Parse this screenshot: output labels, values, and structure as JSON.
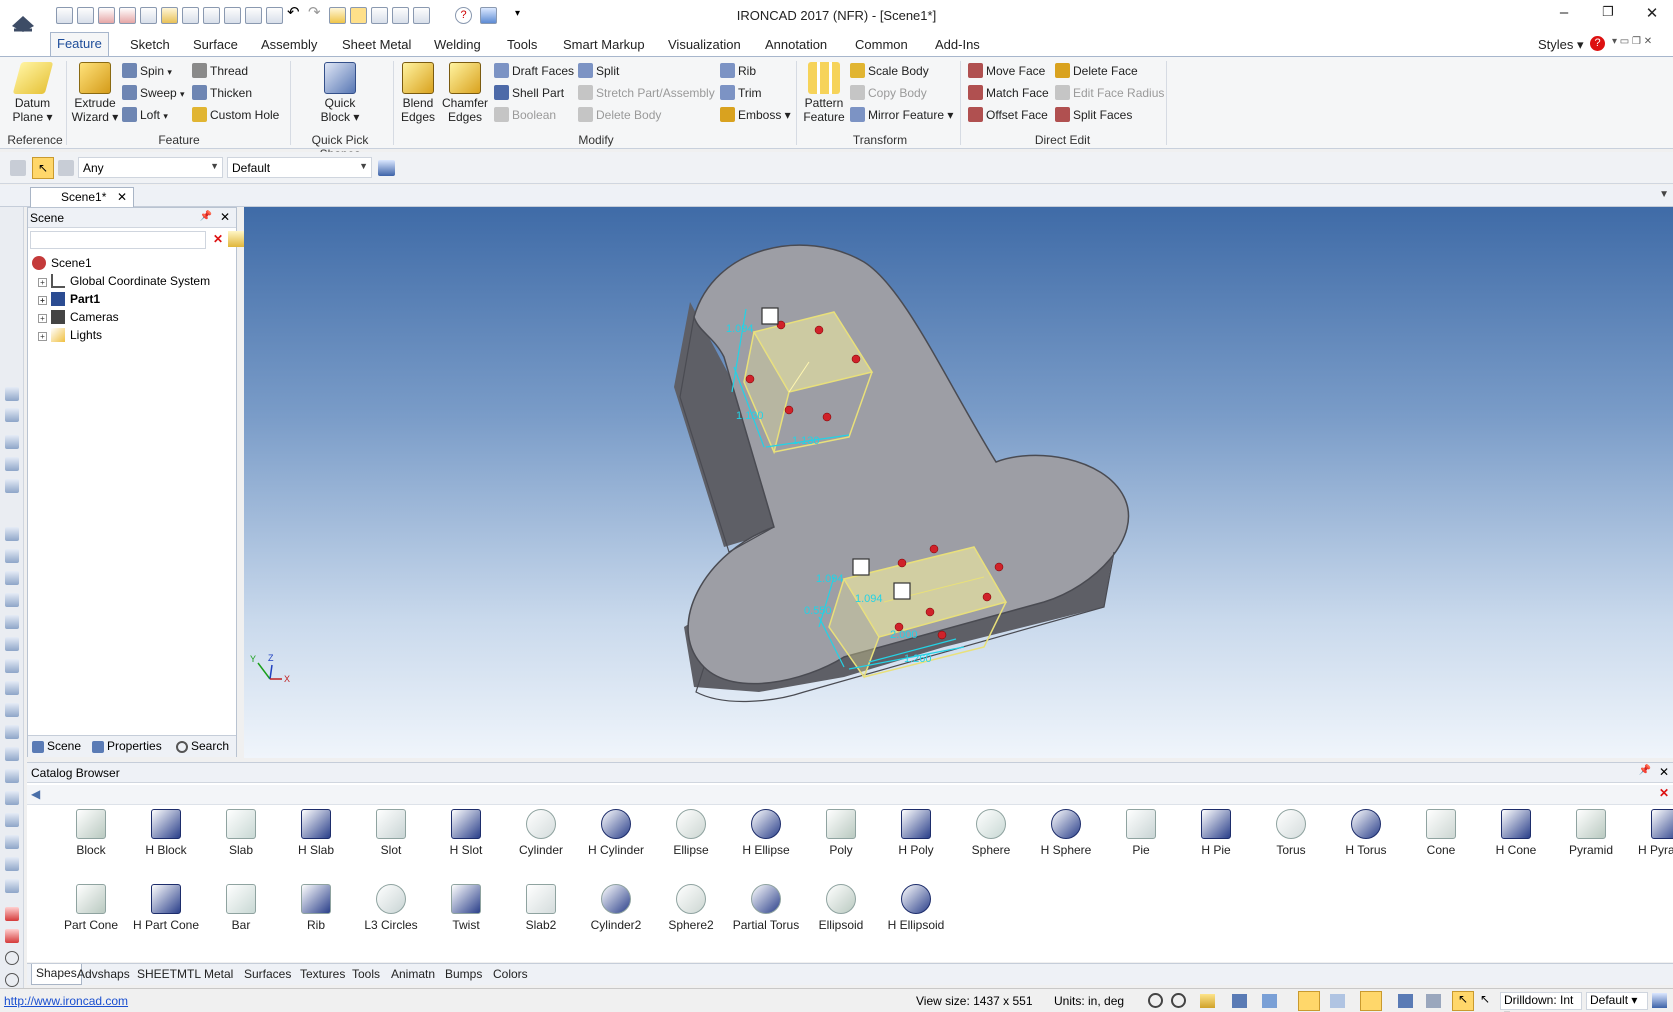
{
  "window": {
    "title": "IRONCAD 2017 (NFR) - [Scene1*]",
    "styles_label": "Styles"
  },
  "ribbon_tabs": [
    "Feature",
    "Sketch",
    "Surface",
    "Assembly",
    "Sheet Metal",
    "Welding",
    "Tools",
    "Smart Markup",
    "Visualization",
    "Annotation",
    "Common",
    "Add-Ins"
  ],
  "ribbon": {
    "reference": {
      "label": "Reference",
      "datum_plane": "Datum Plane",
      "datum_plane_2": "Plane ▾",
      "datum_plane_1": "Datum"
    },
    "feature": {
      "label": "Feature",
      "extrude_1": "Extrude",
      "extrude_2": "Wizard ▾",
      "spin": "Spin",
      "sweep": "Sweep",
      "loft": "Loft",
      "thread": "Thread",
      "thicken": "Thicken",
      "custom_hole": "Custom Hole"
    },
    "quick_pick": {
      "label": "Quick Pick Shapes",
      "quick_1": "Quick",
      "quick_2": "Block ▾"
    },
    "modify": {
      "label": "Modify",
      "blend_1": "Blend",
      "blend_2": "Edges",
      "chamfer_1": "Chamfer",
      "chamfer_2": "Edges",
      "draft_faces": "Draft Faces",
      "shell_part": "Shell Part",
      "boolean": "Boolean",
      "split": "Split",
      "stretch": "Stretch Part/Assembly",
      "delete_body": "Delete Body",
      "rib": "Rib",
      "trim": "Trim",
      "emboss": "Emboss ▾"
    },
    "transform": {
      "label": "Transform",
      "pattern_1": "Pattern",
      "pattern_2": "Feature",
      "scale_body": "Scale Body",
      "copy_body": "Copy Body",
      "mirror_feature": "Mirror Feature ▾"
    },
    "direct_edit": {
      "label": "Direct Edit",
      "move_face": "Move Face",
      "match_face": "Match Face",
      "offset_face": "Offset Face",
      "delete_face": "Delete Face",
      "edit_face_radius": "Edit Face Radius",
      "split_faces": "Split Faces"
    }
  },
  "selection_bar": {
    "filter": "Any",
    "config": "Default"
  },
  "doc_tab": {
    "label": "Scene1*"
  },
  "scene_panel": {
    "title": "Scene",
    "tree": [
      "Scene1",
      "Global Coordinate System",
      "Part1",
      "Cameras",
      "Lights"
    ],
    "bottom_tabs": [
      "Scene",
      "Properties",
      "Search"
    ]
  },
  "viewport": {
    "dims": {
      "top_a": "1.094",
      "top_b": "1.130",
      "top_c": "1.130",
      "bot_a": "1.094",
      "bot_b": "1.094",
      "bot_c": "0.550",
      "bot_d": "2.000",
      "bot_e": "1.260"
    },
    "axis": {
      "y": "Y",
      "z": "Z",
      "x": "X"
    }
  },
  "catalog": {
    "title": "Catalog Browser",
    "row1": [
      "Block",
      "H Block",
      "Slab",
      "H Slab",
      "Slot",
      "H Slot",
      "Cylinder",
      "H Cylinder",
      "Ellipse",
      "H Ellipse",
      "Poly",
      "H Poly",
      "Sphere",
      "H Sphere",
      "Pie",
      "H Pie",
      "Torus",
      "H Torus",
      "Cone",
      "H Cone",
      "Pyramid",
      "H Pyramid"
    ],
    "row2": [
      "Part Cone",
      "H Part Cone",
      "Bar",
      "Rib",
      "L3 Circles",
      "Twist",
      "Slab2",
      "Cylinder2",
      "Sphere2",
      "Partial Torus",
      "Ellipsoid",
      "H Ellipsoid"
    ],
    "tabs": [
      "Shapes",
      "Advshaps",
      "SHEETMTL",
      "Metal",
      "Surfaces",
      "Textures",
      "Tools",
      "Animatn",
      "Bumps",
      "Colors"
    ]
  },
  "status": {
    "link": "http://www.ironcad.com",
    "view_size": "View size: 1437 x  551",
    "units": "Units: in, deg",
    "drilldown": "Drilldown: Int",
    "mode": "Default"
  },
  "colors": {
    "accent": "#1e4d9a",
    "part_gray": "#8f8f96",
    "highlight_yellow": "#f3efa0",
    "dim_cyan": "#22d3e6"
  }
}
